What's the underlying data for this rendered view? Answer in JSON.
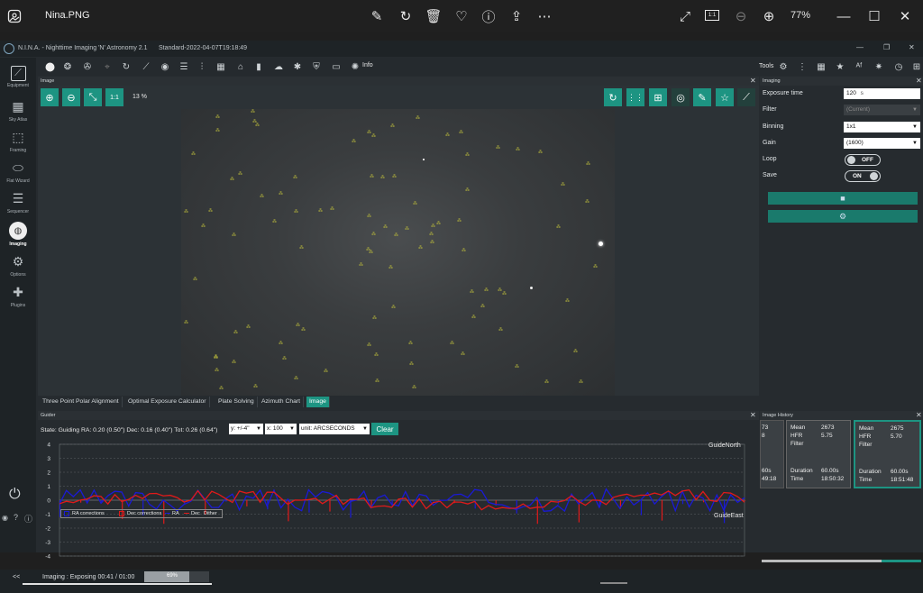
{
  "viewer": {
    "filename": "Nina.PNG",
    "zoom": "77%",
    "fit_label": "1:1"
  },
  "app": {
    "name": "N.I.N.A. - Nighttime Imaging 'N' Astronomy 2.1",
    "profile": "Standard-2022-04-07T19:18:49",
    "info_label": "Info",
    "tools_label": "Tools"
  },
  "nav": [
    {
      "label": "Equipment",
      "icon": "telescope-icon"
    },
    {
      "label": "Sky Atlas",
      "icon": "atlas-icon"
    },
    {
      "label": "Framing",
      "icon": "framing-icon"
    },
    {
      "label": "Flat Wizard",
      "icon": "flat-wizard-icon"
    },
    {
      "label": "Sequencer",
      "icon": "sequencer-icon"
    },
    {
      "label": "Imaging",
      "icon": "imaging-icon"
    },
    {
      "label": "Options",
      "icon": "gear-icon"
    },
    {
      "label": "Plugins",
      "icon": "puzzle-icon"
    }
  ],
  "image_panel": {
    "title": "Image",
    "zoom_percent": "13 %",
    "one_to_one": "1:1"
  },
  "bottom_tabs": [
    "Three Point Polar Alignment",
    "Optimal Exposure Calculator",
    "Plate Solving",
    "Azimuth Chart",
    "Image"
  ],
  "guider": {
    "title": "Guider",
    "state_text": "State: Guiding  RA: 0.20 (0.50\")  Dec: 0.16 (0.40\")  Tot: 0.26 (0.64\")",
    "y_select": "y: +/-4\"",
    "x_select": "x: 100",
    "unit_select": "unit: ARCSECONDS",
    "clear_label": "Clear",
    "north_label": "GuideNorth",
    "east_label": "GuideEast",
    "legend": [
      "RA corrections",
      "Dec corrections",
      "RA",
      "Dec",
      "Dither"
    ],
    "y_ticks": [
      "4",
      "3",
      "2",
      "1",
      "0",
      "-1",
      "-2",
      "-3",
      "-4"
    ]
  },
  "imaging": {
    "title": "Imaging",
    "exposure_label": "Exposure time",
    "exposure_value": "120",
    "exposure_unit": "s",
    "filter_label": "Filter",
    "filter_value": "(Current)",
    "binning_label": "Binning",
    "binning_value": "1x1",
    "gain_label": "Gain",
    "gain_value": "(1600)",
    "loop_label": "Loop",
    "loop_state": "OFF",
    "save_label": "Save",
    "save_state": "ON"
  },
  "history": {
    "title": "Image History",
    "partial": {
      "v1": "73",
      "v2": "8",
      "v3": "60s",
      "v4": "49:18"
    },
    "card1": {
      "mean_label": "Mean",
      "mean": "2673",
      "hfr_label": "HFR",
      "hfr": "5.75",
      "filter_label": "Filter",
      "duration_label": "Duration",
      "duration": "60.00s",
      "time_label": "Time",
      "time": "18:50:32"
    },
    "card2": {
      "mean_label": "Mean",
      "mean": "2675",
      "hfr_label": "HFR",
      "hfr": "5.70",
      "filter_label": "Filter",
      "duration_label": "Duration",
      "duration": "60.00s",
      "time_label": "Time",
      "time": "18:51:48"
    }
  },
  "status": {
    "prefix": "<<",
    "imaging_text": "Imaging :   Exposing 00:41 / 01:00",
    "progress_label": "69%",
    "progress": 0.69
  },
  "colors": {
    "accent": "#1d9482",
    "ra": "#1a1ad6",
    "dec": "#e01a1a"
  }
}
